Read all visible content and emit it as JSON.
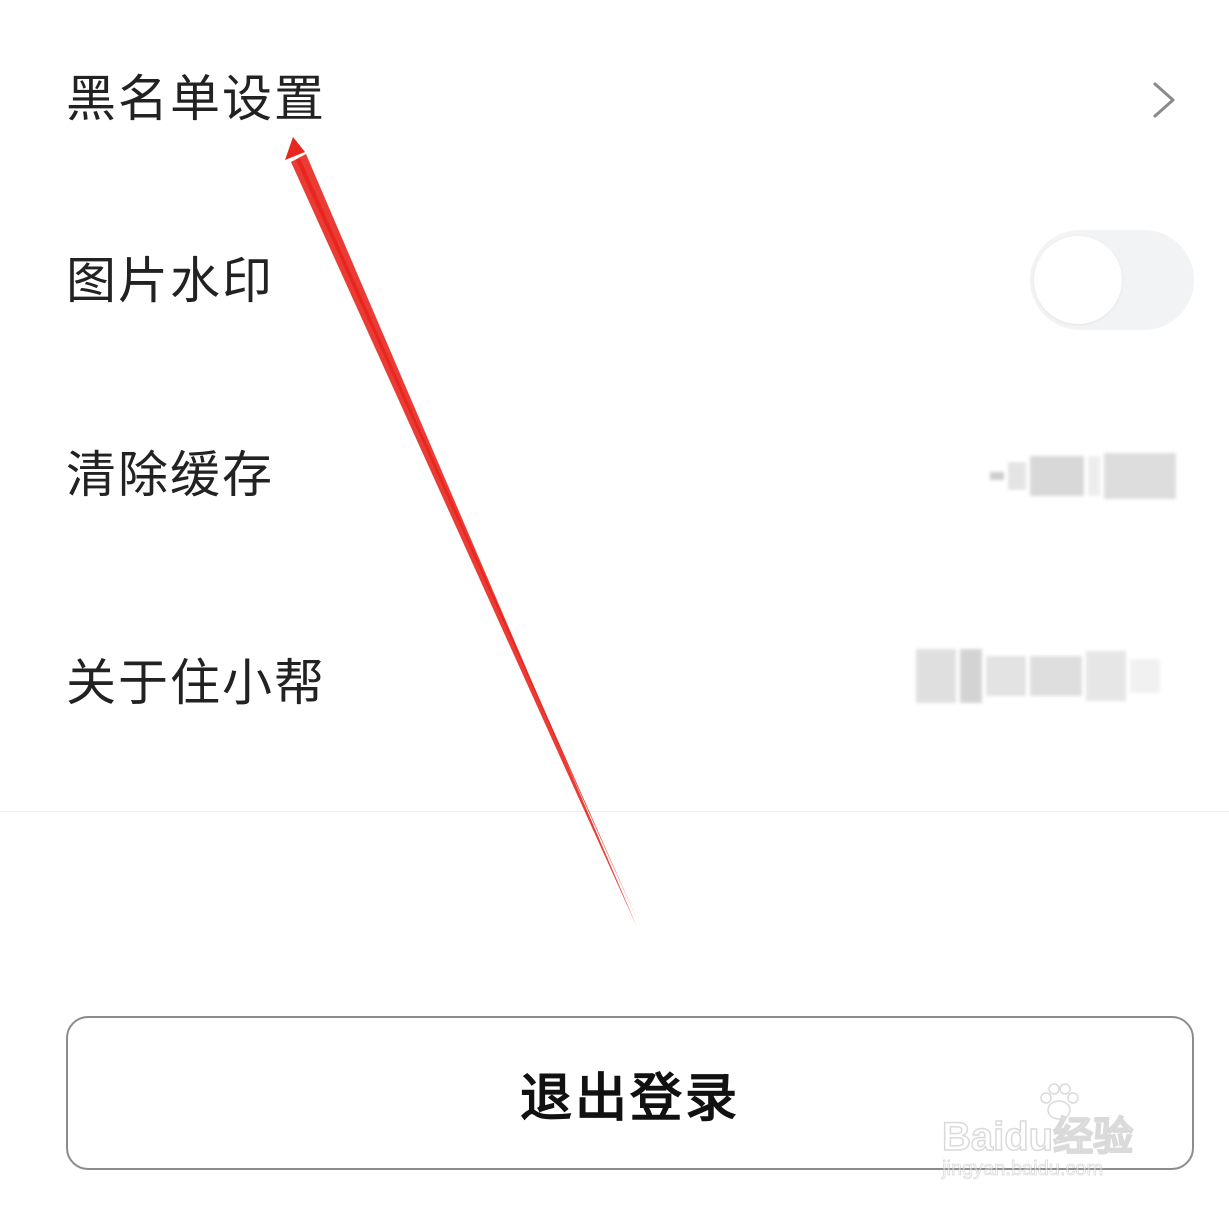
{
  "settings": {
    "blacklist_label": "黑名单设置",
    "watermark_label": "图片水印",
    "watermark_enabled": false,
    "clear_cache_label": "清除缓存",
    "about_label": "关于住小帮"
  },
  "logout": {
    "label": "退出登录"
  },
  "watermark_overlay": {
    "brand": "Baidu经验",
    "url": "jingyan.baidu.com"
  },
  "colors": {
    "annotation_arrow": "#e8271f",
    "toggle_off": "#f2f3f5",
    "text": "#222222",
    "button_border": "#8c8c8c"
  },
  "icons": {
    "blacklist_row": "chevron-right-icon",
    "watermark_brand": "paw-icon"
  }
}
